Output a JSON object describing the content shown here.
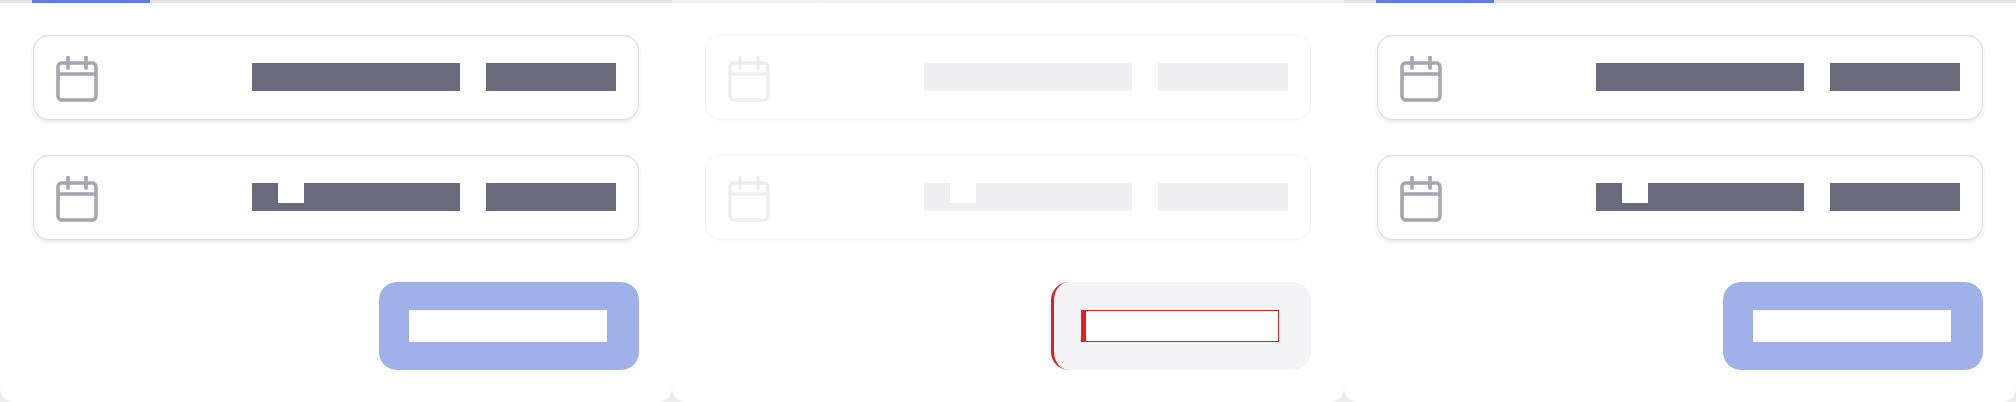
{
  "screens": [
    {
      "state": "default",
      "date_fields": [
        {
          "icon": "calendar-icon",
          "value_redacted": true
        },
        {
          "icon": "calendar-icon",
          "value_redacted": true
        }
      ],
      "confirm_button": {
        "label_redacted": true
      }
    },
    {
      "state": "disabled",
      "date_fields": [
        {
          "icon": "calendar-icon",
          "value_redacted": true
        },
        {
          "icon": "calendar-icon",
          "value_redacted": true
        }
      ],
      "confirm_button": {
        "label_redacted": true,
        "focus_outline_color": "#e02020"
      }
    },
    {
      "state": "default",
      "date_fields": [
        {
          "icon": "calendar-icon",
          "value_redacted": true
        },
        {
          "icon": "calendar-icon",
          "value_redacted": true
        }
      ],
      "confirm_button": {
        "label_redacted": true
      }
    }
  ],
  "colors": {
    "accent": "#5f7fe0",
    "button_fill": "#9fb1e8",
    "redaction": "#696b7c",
    "icon": "#a4a4b2",
    "card_border": "#dcdde3",
    "focus_outline": "#e02020"
  }
}
